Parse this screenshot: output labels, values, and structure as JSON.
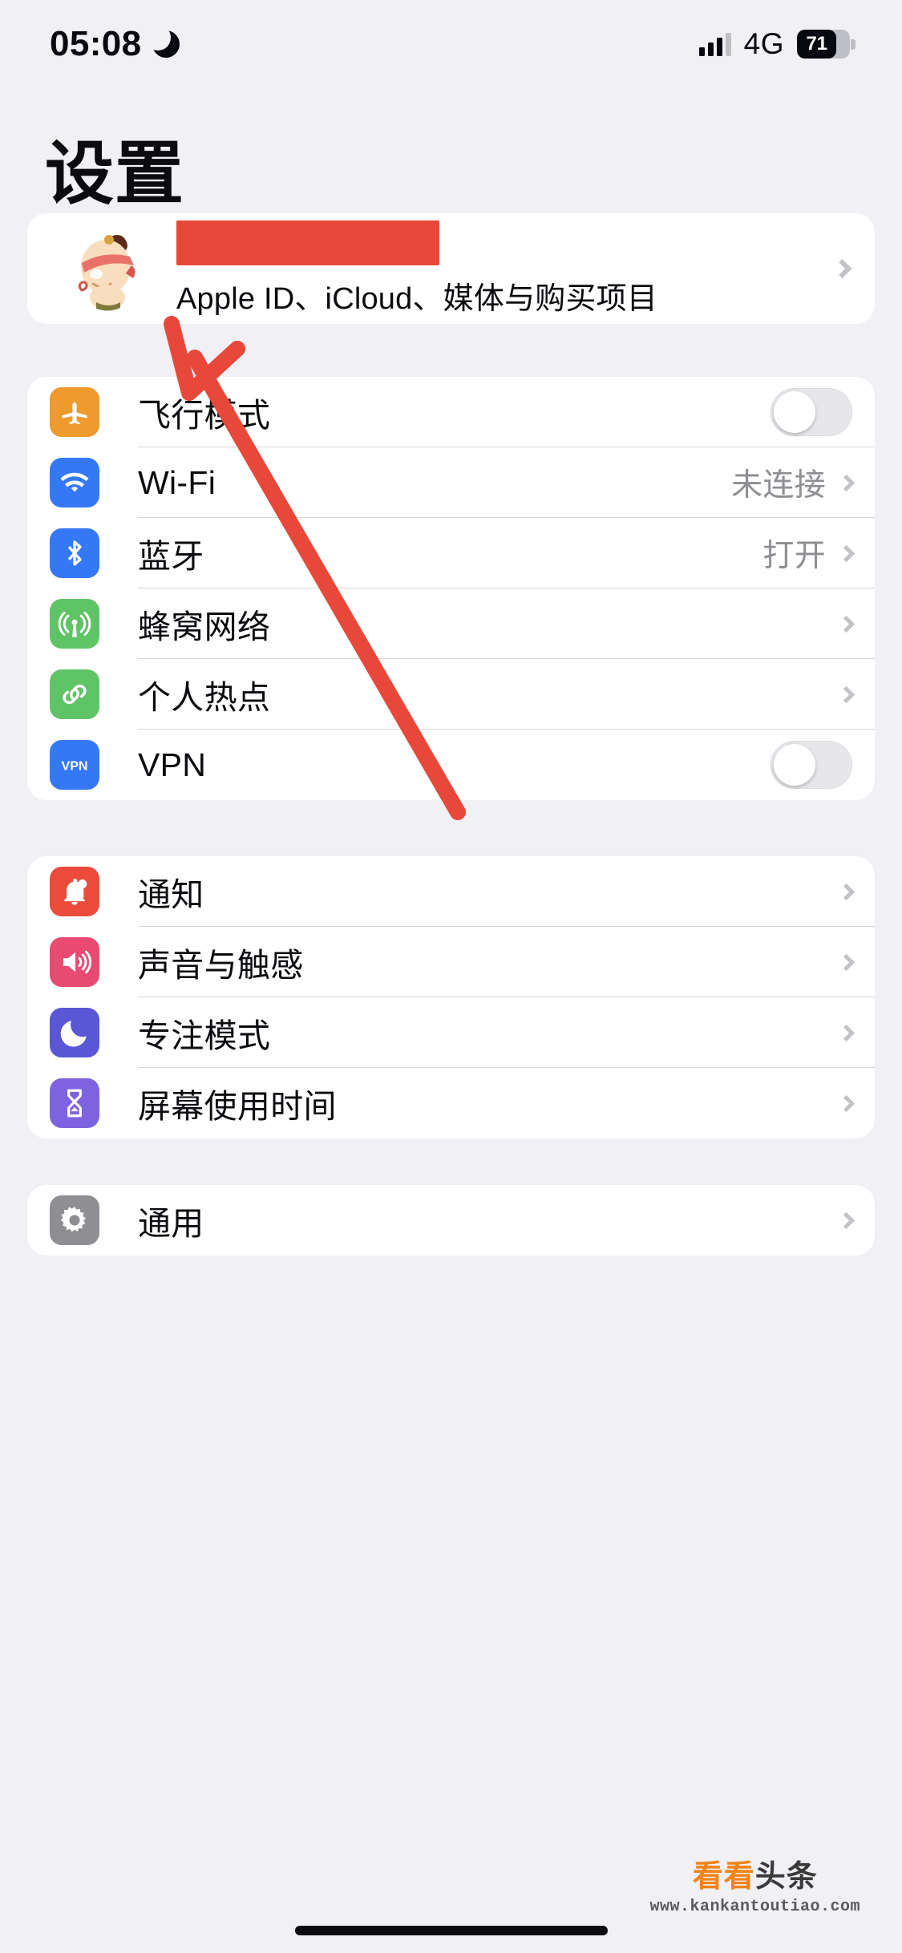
{
  "status_bar": {
    "time": "05:08",
    "dnd_icon": "crescent-moon-icon",
    "signal_icon": "cellular-signal-icon",
    "network": "4G",
    "battery_percent": "71",
    "battery_level": 71
  },
  "header": {
    "title": "设置"
  },
  "apple_id": {
    "avatar_label": "用户头像",
    "name_redacted": "",
    "subtitle": "Apple ID、iCloud、媒体与购买项目",
    "chevron": "chevron-right-icon"
  },
  "groups": [
    {
      "id": "connectivity",
      "rows": [
        {
          "label": "飞行模式",
          "icon": "airplane-icon",
          "icon_color": "#EE9A2D",
          "accessory": "toggle",
          "toggle_on": false
        },
        {
          "label": "Wi-Fi",
          "icon": "wifi-icon",
          "icon_color": "#3478F6",
          "accessory": "value",
          "value": "未连接"
        },
        {
          "label": "蓝牙",
          "icon": "bluetooth-icon",
          "icon_color": "#3478F6",
          "accessory": "value",
          "value": "打开"
        },
        {
          "label": "蜂窝网络",
          "icon": "cellular-tower-icon",
          "icon_color": "#5FC466",
          "accessory": "chevron",
          "value": ""
        },
        {
          "label": "个人热点",
          "icon": "hotspot-link-icon",
          "icon_color": "#5FC466",
          "accessory": "chevron",
          "value": ""
        },
        {
          "label": "VPN",
          "icon": "vpn-icon",
          "icon_color": "#3478F6",
          "accessory": "toggle",
          "toggle_on": false
        }
      ]
    },
    {
      "id": "alerts",
      "rows": [
        {
          "label": "通知",
          "icon": "bell-icon",
          "icon_color": "#EC4B3B",
          "accessory": "chevron",
          "value": ""
        },
        {
          "label": "声音与触感",
          "icon": "speaker-icon",
          "icon_color": "#E94A72",
          "accessory": "chevron",
          "value": ""
        },
        {
          "label": "专注模式",
          "icon": "moon-focus-icon",
          "icon_color": "#5A56D6",
          "accessory": "chevron",
          "value": ""
        },
        {
          "label": "屏幕使用时间",
          "icon": "hourglass-icon",
          "icon_color": "#7E63E0",
          "accessory": "chevron",
          "value": ""
        }
      ]
    },
    {
      "id": "general",
      "rows": [
        {
          "label": "通用",
          "icon": "gear-icon",
          "icon_color": "#8E8E93",
          "accessory": "chevron",
          "value": ""
        }
      ]
    }
  ],
  "annotation": {
    "type": "arrow",
    "color": "#E8483A",
    "points_to": "apple-id-card"
  },
  "watermark": {
    "brand_part1": "看看",
    "brand_part2": "头条",
    "url": "www.kankantoutiao.com"
  },
  "colors": {
    "background": "#F0F0F5",
    "card": "#FFFFFF",
    "separator": "#D6D6DB",
    "secondary_text": "#8E8E93",
    "annotation_red": "#E8483A"
  }
}
